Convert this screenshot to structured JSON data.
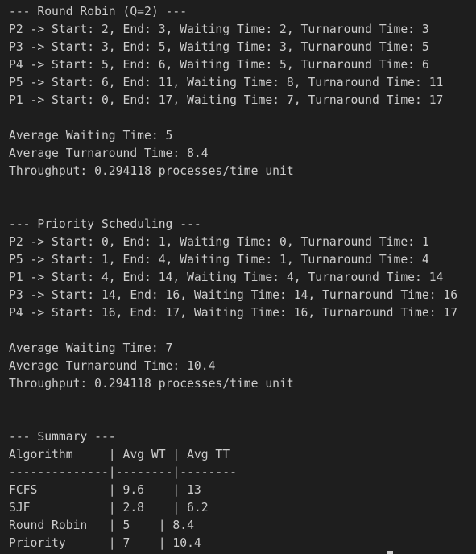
{
  "terminal": {
    "lines": [
      "--- Round Robin (Q=2) ---",
      "P2 -> Start: 2, End: 3, Waiting Time: 2, Turnaround Time: 3",
      "P3 -> Start: 3, End: 5, Waiting Time: 3, Turnaround Time: 5",
      "P4 -> Start: 5, End: 6, Waiting Time: 5, Turnaround Time: 6",
      "P5 -> Start: 6, End: 11, Waiting Time: 8, Turnaround Time: 11",
      "P1 -> Start: 0, End: 17, Waiting Time: 7, Turnaround Time: 17",
      "",
      "Average Waiting Time: 5",
      "Average Turnaround Time: 8.4",
      "Throughput: 0.294118 processes/time unit",
      "",
      "",
      "--- Priority Scheduling ---",
      "P2 -> Start: 0, End: 1, Waiting Time: 0, Turnaround Time: 1",
      "P5 -> Start: 1, End: 4, Waiting Time: 1, Turnaround Time: 4",
      "P1 -> Start: 4, End: 14, Waiting Time: 4, Turnaround Time: 14",
      "P3 -> Start: 14, End: 16, Waiting Time: 14, Turnaround Time: 16",
      "P4 -> Start: 16, End: 17, Waiting Time: 16, Turnaround Time: 17",
      "",
      "Average Waiting Time: 7",
      "Average Turnaround Time: 10.4",
      "Throughput: 0.294118 processes/time unit",
      "",
      "",
      "--- Summary ---",
      "Algorithm     | Avg WT | Avg TT",
      "--------------|--------|--------",
      "FCFS          | 9.6    | 13",
      "SJF           | 2.8    | 6.2",
      "Round Robin   | 5    | 8.4",
      "Priority      | 7    | 10.4"
    ]
  },
  "colors": {
    "background": "#1e1e1e",
    "foreground": "#cccccc"
  }
}
